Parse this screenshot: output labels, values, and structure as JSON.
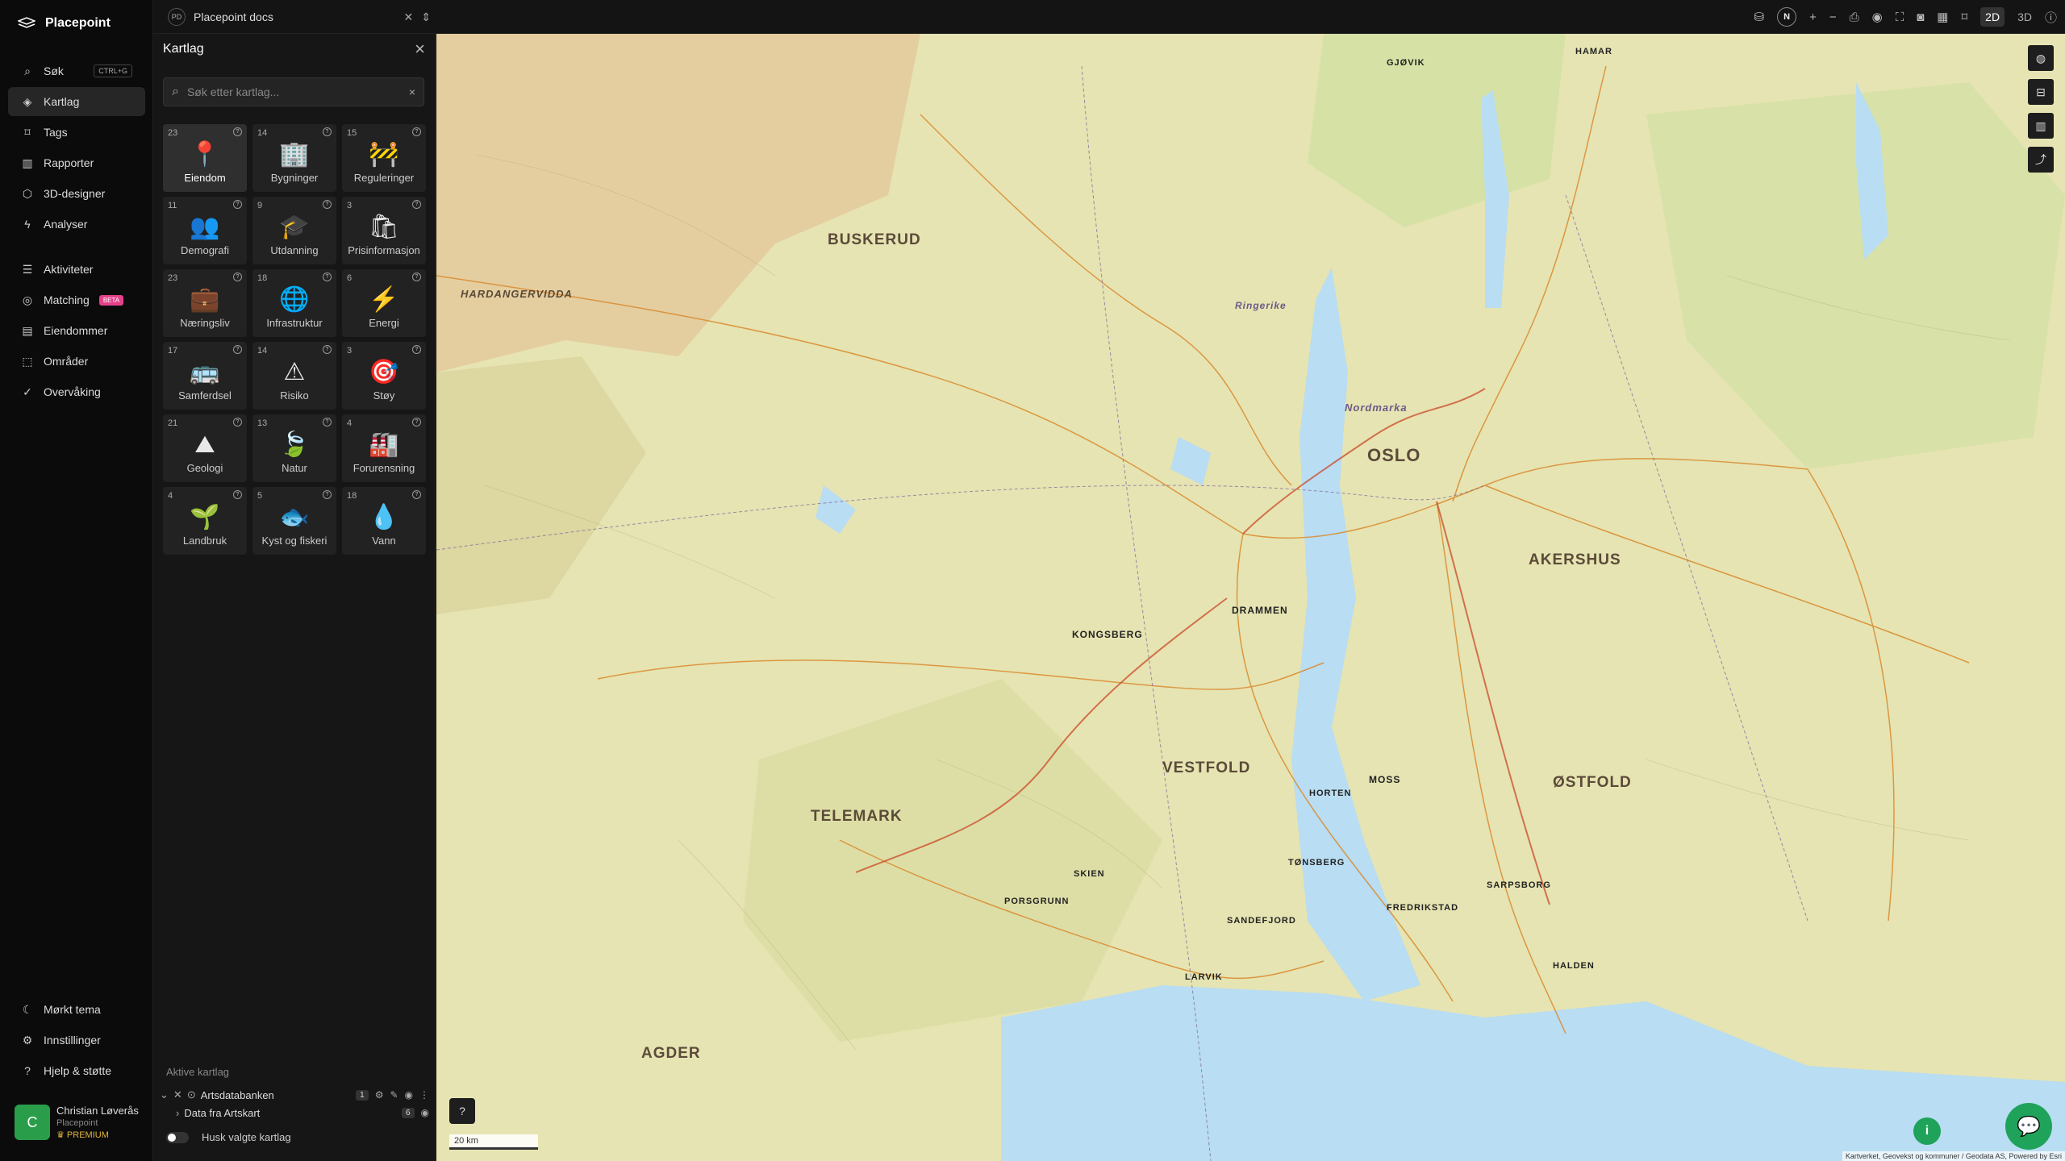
{
  "app": {
    "name": "Placepoint"
  },
  "topbar": {
    "doc_badge": "PD",
    "doc_name": "Placepoint docs",
    "north": "N",
    "view_2d": "2D",
    "view_3d": "3D"
  },
  "nav": {
    "items": [
      {
        "label": "Søk",
        "icon": "search-icon",
        "shortcut": "CTRL+G"
      },
      {
        "label": "Kartlag",
        "icon": "layers-icon",
        "active": true
      },
      {
        "label": "Tags",
        "icon": "bookmark-icon"
      },
      {
        "label": "Rapporter",
        "icon": "chart-icon"
      },
      {
        "label": "3D-designer",
        "icon": "cube-icon"
      },
      {
        "label": "Analyser",
        "icon": "lightning-icon"
      }
    ],
    "items2": [
      {
        "label": "Aktiviteter",
        "icon": "activity-icon"
      },
      {
        "label": "Matching",
        "icon": "target-icon",
        "badge": "BETA"
      },
      {
        "label": "Eiendommer",
        "icon": "document-icon"
      },
      {
        "label": "Områder",
        "icon": "area-icon"
      },
      {
        "label": "Overvåking",
        "icon": "check-circle-icon"
      }
    ],
    "bottom": [
      {
        "label": "Mørkt tema",
        "icon": "moon-icon"
      },
      {
        "label": "Innstillinger",
        "icon": "gear-icon"
      },
      {
        "label": "Hjelp & støtte",
        "icon": "help-icon"
      }
    ]
  },
  "user": {
    "initial": "C",
    "name": "Christian Løverås",
    "org": "Placepoint",
    "tier": "PREMIUM"
  },
  "panel": {
    "title": "Kartlag",
    "search_placeholder": "Søk etter kartlag...",
    "tiles": [
      {
        "count": "23",
        "label": "Eiendom",
        "icon": "📍",
        "selected": true
      },
      {
        "count": "14",
        "label": "Bygninger",
        "icon": "🏢"
      },
      {
        "count": "15",
        "label": "Reguleringer",
        "icon": "🚧"
      },
      {
        "count": "11",
        "label": "Demografi",
        "icon": "👥"
      },
      {
        "count": "9",
        "label": "Utdanning",
        "icon": "🎓"
      },
      {
        "count": "3",
        "label": "Prisinformasjon",
        "icon": "🛍"
      },
      {
        "count": "23",
        "label": "Næringsliv",
        "icon": "💼"
      },
      {
        "count": "18",
        "label": "Infrastruktur",
        "icon": "🌐"
      },
      {
        "count": "6",
        "label": "Energi",
        "icon": "⚡"
      },
      {
        "count": "17",
        "label": "Samferdsel",
        "icon": "🚌"
      },
      {
        "count": "14",
        "label": "Risiko",
        "icon": "⚠"
      },
      {
        "count": "3",
        "label": "Støy",
        "icon": "🎯"
      },
      {
        "count": "21",
        "label": "Geologi",
        "icon": "⛰"
      },
      {
        "count": "13",
        "label": "Natur",
        "icon": "🍃"
      },
      {
        "count": "4",
        "label": "Forurensning",
        "icon": "🏭"
      },
      {
        "count": "4",
        "label": "Landbruk",
        "icon": "🌱"
      },
      {
        "count": "5",
        "label": "Kyst og fiskeri",
        "icon": "🐟"
      },
      {
        "count": "18",
        "label": "Vann",
        "icon": "💧"
      }
    ],
    "active_title": "Aktive kartlag",
    "active_layers": [
      {
        "label": "Artsdatabanken",
        "count": "1"
      },
      {
        "label": "Data fra Artskart",
        "count": "6"
      }
    ],
    "remember_label": "Husk valgte kartlag"
  },
  "map": {
    "labels": [
      {
        "text": "BUSKERUD"
      },
      {
        "text": "OSLO"
      },
      {
        "text": "AKERSHUS"
      },
      {
        "text": "VESTFOLD"
      },
      {
        "text": "TELEMARK"
      },
      {
        "text": "ØSTFOLD"
      },
      {
        "text": "AGDER"
      },
      {
        "text": "HARDANGERVIDDA"
      },
      {
        "text": "DRAMMEN"
      },
      {
        "text": "KONGSBERG"
      },
      {
        "text": "TØNSBERG"
      },
      {
        "text": "SANDEFJORD"
      },
      {
        "text": "LARVIK"
      },
      {
        "text": "PORSGRUNN"
      },
      {
        "text": "SKIEN"
      },
      {
        "text": "MOSS"
      },
      {
        "text": "HORTEN"
      },
      {
        "text": "FREDRIKSTAD"
      },
      {
        "text": "SARPSBORG"
      },
      {
        "text": "HALDEN"
      },
      {
        "text": "GJØVIK"
      },
      {
        "text": "HAMAR"
      },
      {
        "text": "Nordmarka"
      },
      {
        "text": "Ringerike"
      }
    ],
    "scale": "20 km",
    "attribution": "Kartverket, Geovekst og kommuner / Geodata AS, Powered by Esri"
  }
}
